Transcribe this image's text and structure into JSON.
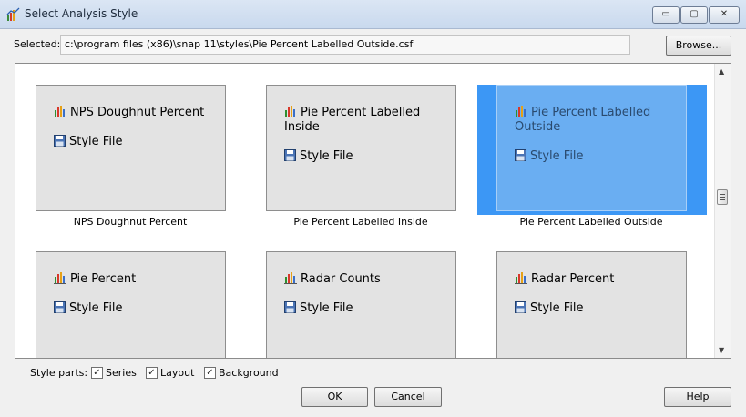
{
  "window": {
    "title": "Select Analysis Style",
    "minimize": "▭",
    "maximize": "▢",
    "close": "✕"
  },
  "selected": {
    "label": "Selected:",
    "value": "c:\\program files (x86)\\snap 11\\styles\\Pie Percent Labelled Outside.csf",
    "browse": "Browse..."
  },
  "styles": [
    {
      "name": "NPS Doughnut Percent",
      "name_line1": "NPS Doughnut Percent",
      "name_line2": "",
      "type": "Style File",
      "caption": "NPS Doughnut Percent",
      "selected": false
    },
    {
      "name": "Pie Percent Labelled Inside",
      "name_line1": "Pie Percent Labelled",
      "name_line2": "Inside",
      "type": "Style File",
      "caption": "Pie Percent Labelled Inside",
      "selected": false
    },
    {
      "name": "Pie Percent Labelled Outside",
      "name_line1": "Pie Percent Labelled",
      "name_line2": "Outside",
      "type": "Style File",
      "caption": "Pie Percent Labelled Outside",
      "selected": true
    },
    {
      "name": "Pie Percent",
      "name_line1": "Pie Percent",
      "name_line2": "",
      "type": "Style File",
      "caption": "",
      "selected": false
    },
    {
      "name": "Radar Counts",
      "name_line1": "Radar Counts",
      "name_line2": "",
      "type": "Style File",
      "caption": "",
      "selected": false
    },
    {
      "name": "Radar Percent",
      "name_line1": "Radar Percent",
      "name_line2": "",
      "type": "Style File",
      "caption": "",
      "selected": false
    }
  ],
  "style_parts": {
    "label": "Style parts:",
    "series": {
      "label": "Series",
      "checked": true
    },
    "layout": {
      "label": "Layout",
      "checked": true
    },
    "background": {
      "label": "Background",
      "checked": true
    },
    "check_glyph": "✓"
  },
  "buttons": {
    "ok": "OK",
    "cancel": "Cancel",
    "help": "Help"
  },
  "scroll": {
    "up": "▲",
    "down": "▼"
  },
  "icons": {
    "chart": "bar-chart-icon",
    "file": "floppy-disk-icon"
  },
  "colors": {
    "selection": "#3c97f5",
    "card": "#e3e3e3"
  }
}
